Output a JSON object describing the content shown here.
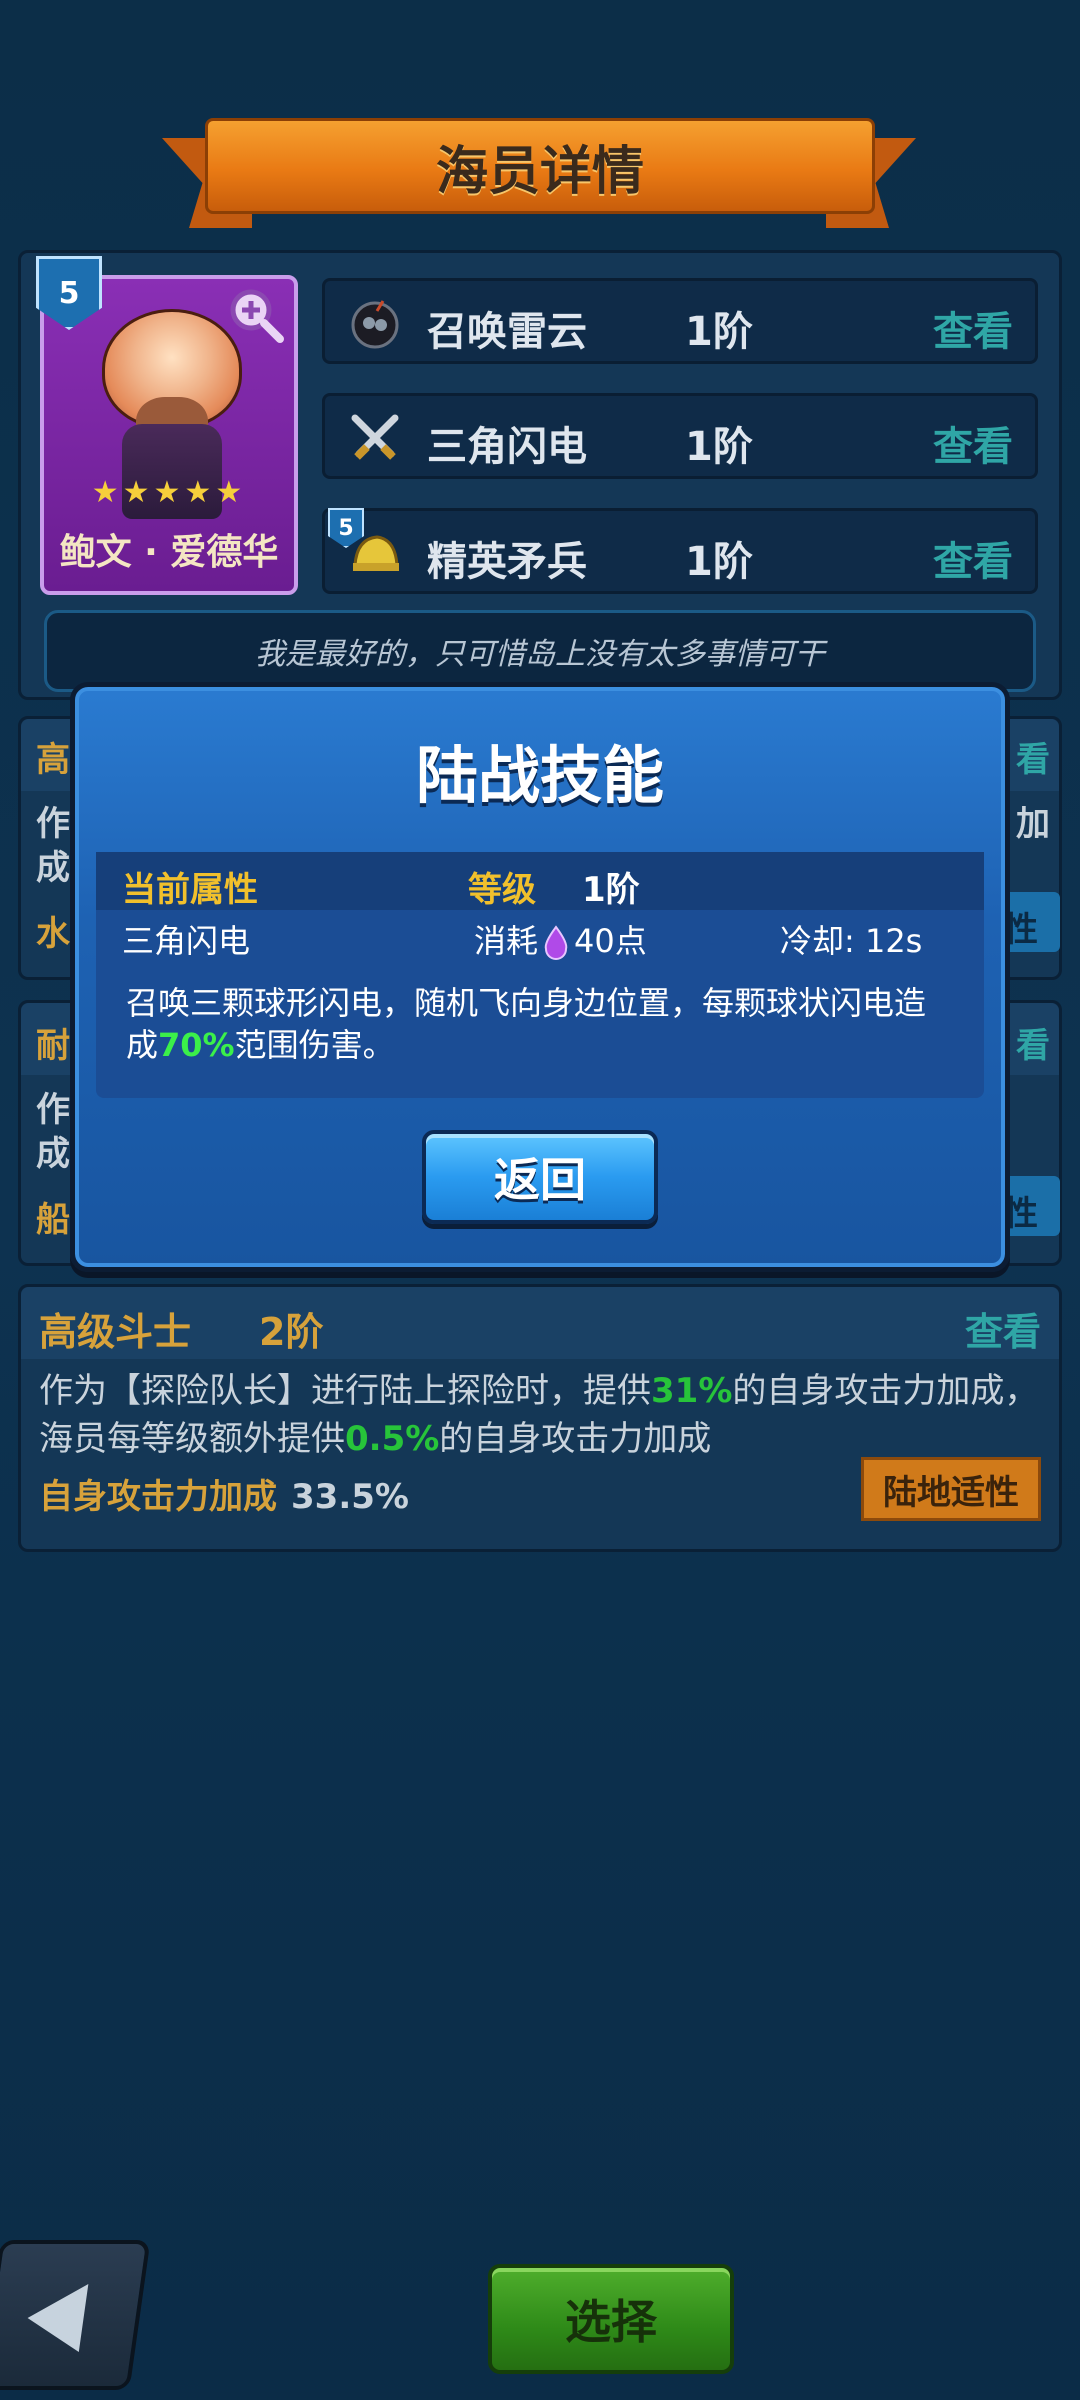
{
  "header": {
    "title": "海员详情"
  },
  "character": {
    "name": "鲍文 · 爱德华",
    "level": "5",
    "stars": "★★★★★"
  },
  "skills": [
    {
      "name": "召唤雷云",
      "level": "1阶",
      "action": "查看",
      "icon": "storm-cloud-icon"
    },
    {
      "name": "三角闪电",
      "level": "1阶",
      "action": "查看",
      "icon": "crossed-swords-icon"
    },
    {
      "name": "精英矛兵",
      "level": "1阶",
      "action": "查看",
      "icon": "helmet-icon",
      "badge": "5"
    }
  ],
  "quote": "我是最好的，只可惜岛上没有太多事情可干",
  "sections": [
    {
      "peek_left": "高",
      "peek_right": "看",
      "peek_line1": "作",
      "peek_line1_right": "加",
      "peek_line2": "成",
      "peek_stat": "水",
      "peek_btn": "性"
    },
    {
      "peek_left": "耐",
      "peek_right": "看",
      "peek_line1": "作",
      "peek_line2": "成",
      "peek_stat": "船",
      "peek_btn": "性"
    },
    {
      "title": "高级斗士",
      "level": "2阶",
      "action": "查看",
      "desc_a": "作为【探险队长】进行陆上探险时，提供",
      "desc_g1": "31%",
      "desc_b": "的自身攻击力加成，海员每等级额外提供",
      "desc_g2": "0.5%",
      "desc_c": "的自身攻击力加成",
      "stat_label": "自身攻击力加成",
      "stat_value": "33.5%",
      "tag": "陆地适性"
    }
  ],
  "modal": {
    "title": "陆战技能",
    "current_attr_label": "当前属性",
    "grade_label": "等级",
    "grade_value": "1阶",
    "skill_name": "三角闪电",
    "cost_label": "消耗",
    "cost_value": "40点",
    "cooldown": "冷却: 12s",
    "desc_a": "召唤三颗球形闪电，随机飞向身边位置，每颗球状闪电造成",
    "desc_g": "70%",
    "desc_b": "范围伤害。",
    "back_button": "返回"
  },
  "footer": {
    "back_icon": "back-arrow-icon",
    "select_button": "选择"
  },
  "colors": {
    "accent_gold": "#d7a23b",
    "teal": "#2fa6a6",
    "highlight_green": "#27c43a",
    "modal_blue": "#1e62b3"
  }
}
